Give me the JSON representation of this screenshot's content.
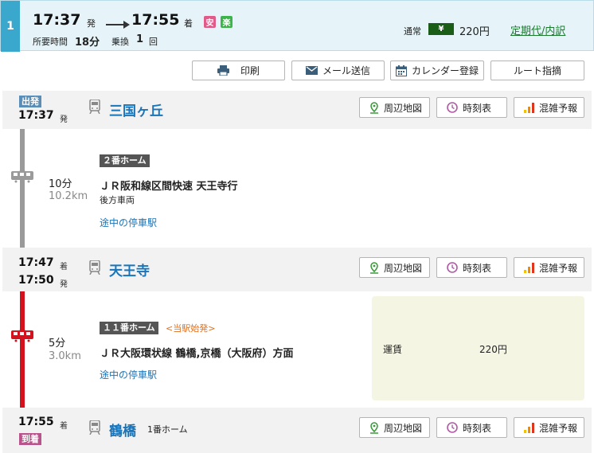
{
  "route": {
    "index": "1",
    "dep_time": "17:37",
    "dep_suffix": "発",
    "arr_time": "17:55",
    "arr_suffix": "着",
    "badge_safe": "安",
    "badge_easy": "楽",
    "duration_label": "所要時間",
    "duration_value": "18分",
    "transfer_label": "乗換",
    "transfer_value": "1",
    "transfer_unit": "回",
    "fare_type": "通常",
    "yen_symbol": "¥",
    "fare": "220円",
    "commuter_link": "定期代/内訳"
  },
  "toolbar": {
    "print": "印刷",
    "mail": "メール送信",
    "calendar": "カレンダー登録",
    "route_spec": "ルート指摘"
  },
  "station_buttons": {
    "map": "周辺地図",
    "timetable": "時刻表",
    "congestion": "混雑予報"
  },
  "stations": [
    {
      "tag": "出発",
      "time1": "17:37",
      "suffix1": "発",
      "name": "三国ヶ丘",
      "platform": ""
    },
    {
      "time1": "17:47",
      "suffix1": "着",
      "time2": "17:50",
      "suffix2": "発",
      "name": "天王寺",
      "platform": ""
    },
    {
      "tag": "到着",
      "time1": "17:55",
      "suffix1": "着",
      "name": "鶴橋",
      "platform": "1番ホーム"
    }
  ],
  "segments": [
    {
      "minutes": "10分",
      "distance": "10.2km",
      "platform": "２番ホーム",
      "line": "ＪＲ阪和線区間快速 天王寺行",
      "car": "後方車両",
      "stops_link": "途中の停車駅",
      "color": "#9a9a9a"
    },
    {
      "minutes": "5分",
      "distance": "3.0km",
      "platform": "１１番ホーム",
      "note": "<当駅始発>",
      "line": "ＪＲ大阪環状線 鶴橋,京橋（大阪府）方面",
      "stops_link": "途中の停車駅",
      "color": "#d4121d"
    }
  ],
  "fare_box": {
    "label": "運賃",
    "value": "220円",
    "bg": "#f5f5e4"
  }
}
